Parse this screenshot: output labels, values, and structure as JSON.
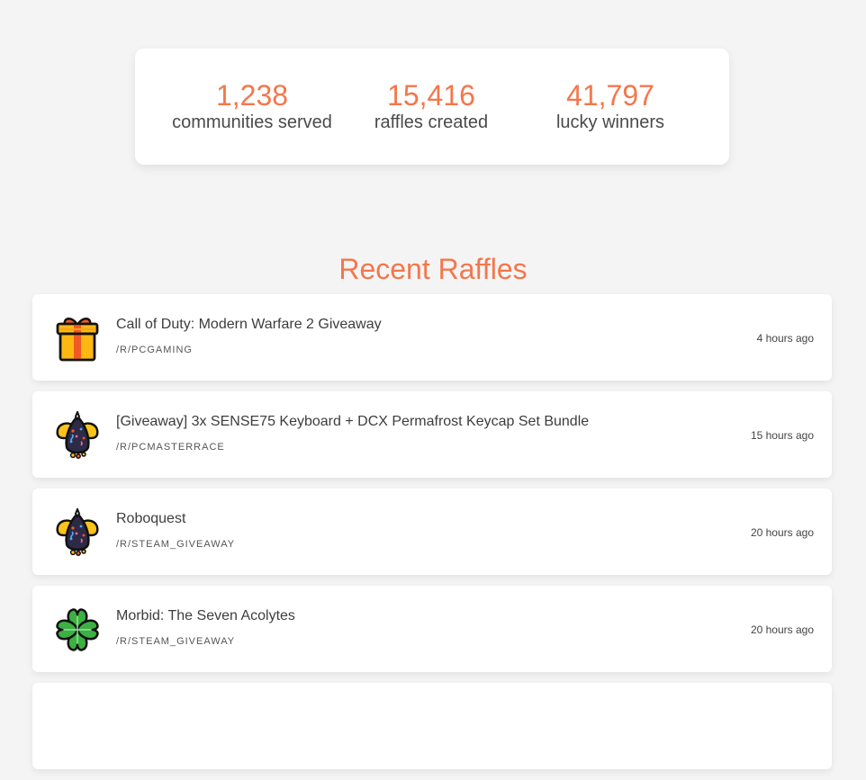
{
  "stats": [
    {
      "value": "1,238",
      "label": "communities served"
    },
    {
      "value": "15,416",
      "label": "raffles created"
    },
    {
      "value": "41,797",
      "label": "lucky winners"
    }
  ],
  "section_title": "Recent Raffles",
  "raffles": [
    {
      "title": "Call of Duty: Modern Warfare 2 Giveaway",
      "subreddit": "/R/PCGAMING",
      "time": "4 hours ago",
      "icon": "gift-icon"
    },
    {
      "title": "[Giveaway] 3x SENSE75 Keyboard + DCX Permafrost Keycap Set Bundle",
      "subreddit": "/R/PCMASTERRACE",
      "time": "15 hours ago",
      "icon": "party-popper-icon"
    },
    {
      "title": "Roboquest",
      "subreddit": "/R/STEAM_GIVEAWAY",
      "time": "20 hours ago",
      "icon": "party-popper-icon"
    },
    {
      "title": "Morbid: The Seven Acolytes",
      "subreddit": "/R/STEAM_GIVEAWAY",
      "time": "20 hours ago",
      "icon": "four-leaf-clover-icon"
    }
  ],
  "colors": {
    "accent": "#f4774b",
    "background": "#f4f4f4",
    "card": "#ffffff"
  }
}
